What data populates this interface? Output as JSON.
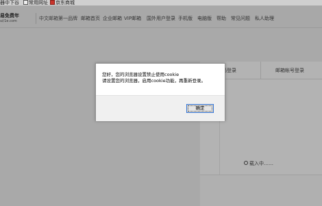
{
  "bookmarks": {
    "items": [
      {
        "label": "器中下谷",
        "icon": "bookmark-icon"
      },
      {
        "label": "常用网址",
        "icon": "page-icon"
      },
      {
        "label": "京东商城",
        "icon": "jd-logo-icon"
      }
    ]
  },
  "header": {
    "logo_title": "易免费年",
    "logo_sub": "ui/1e.com",
    "slogan": "中文邮箱第一品牌",
    "nav": [
      "邮箱首页",
      "企业邮箱",
      "VIP邮箱",
      "国外用户登录",
      "手机版",
      "电脑版",
      "帮助",
      "常见问题",
      "私人助理"
    ]
  },
  "login": {
    "tab_left": "码登录",
    "tab_right": "邮箱帐号登录",
    "loading": "载入中……"
  },
  "dialog": {
    "line1": "您好，您的浏览器设置禁止使用cookie",
    "line2": "请设置您的浏览器，启用cookie功能，再重新登录。",
    "ok_label": "确定"
  },
  "colors": {
    "overlay_gray": "#a9a9a9",
    "dialog_bg": "#ffffff",
    "footer_bg": "#f0f0f0",
    "button_focus": "#2d6fd1"
  }
}
